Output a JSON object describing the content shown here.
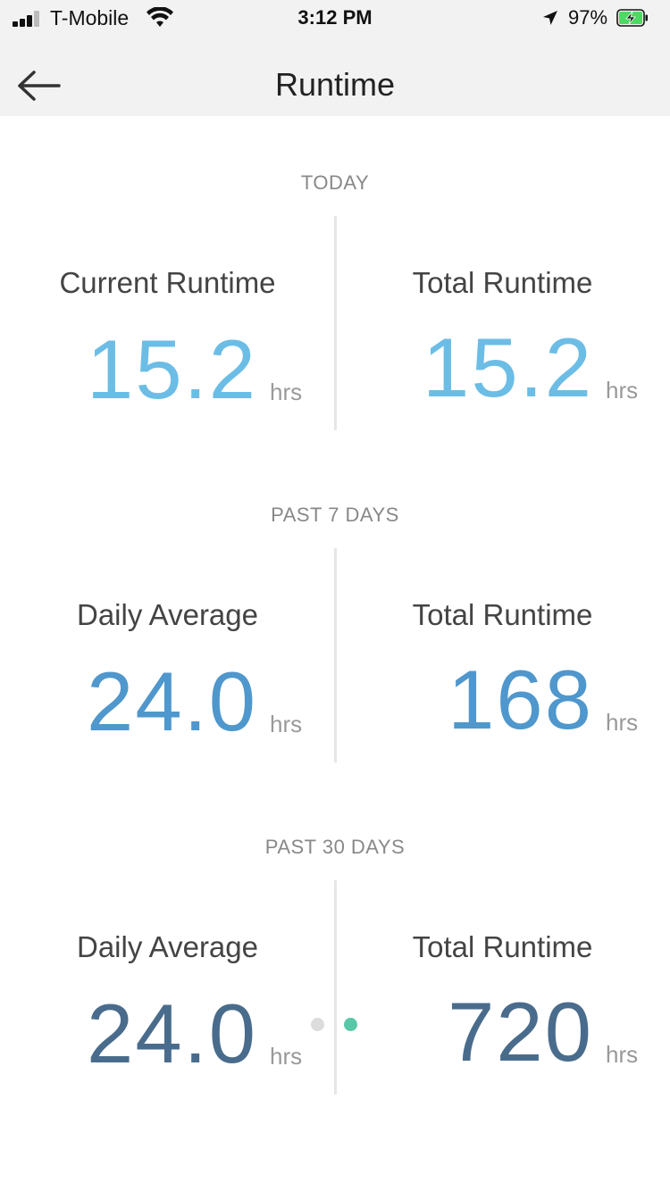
{
  "status_bar": {
    "carrier": "T-Mobile",
    "time": "3:12 PM",
    "battery_percent": "97%"
  },
  "header": {
    "title": "Runtime",
    "back_icon": "arrow-left-icon"
  },
  "colors": {
    "today_value": "#6cbde6",
    "week_value": "#4f97cc",
    "month_value": "#4a6c8c",
    "dot_inactive": "#dcdcdc",
    "dot_active": "#56c8a8"
  },
  "sections": [
    {
      "label": "TODAY",
      "left": {
        "label": "Current Runtime",
        "value": "15.2",
        "unit": "hrs"
      },
      "right": {
        "label": "Total Runtime",
        "value": "15.2",
        "unit": "hrs"
      }
    },
    {
      "label": "PAST 7 DAYS",
      "left": {
        "label": "Daily Average",
        "value": "24.0",
        "unit": "hrs"
      },
      "right": {
        "label": "Total Runtime",
        "value": "168",
        "unit": "hrs"
      }
    },
    {
      "label": "PAST 30 DAYS",
      "left": {
        "label": "Daily Average",
        "value": "24.0",
        "unit": "hrs"
      },
      "right": {
        "label": "Total Runtime",
        "value": "720",
        "unit": "hrs"
      }
    }
  ],
  "pager": {
    "count": 2,
    "active_index": 1
  }
}
